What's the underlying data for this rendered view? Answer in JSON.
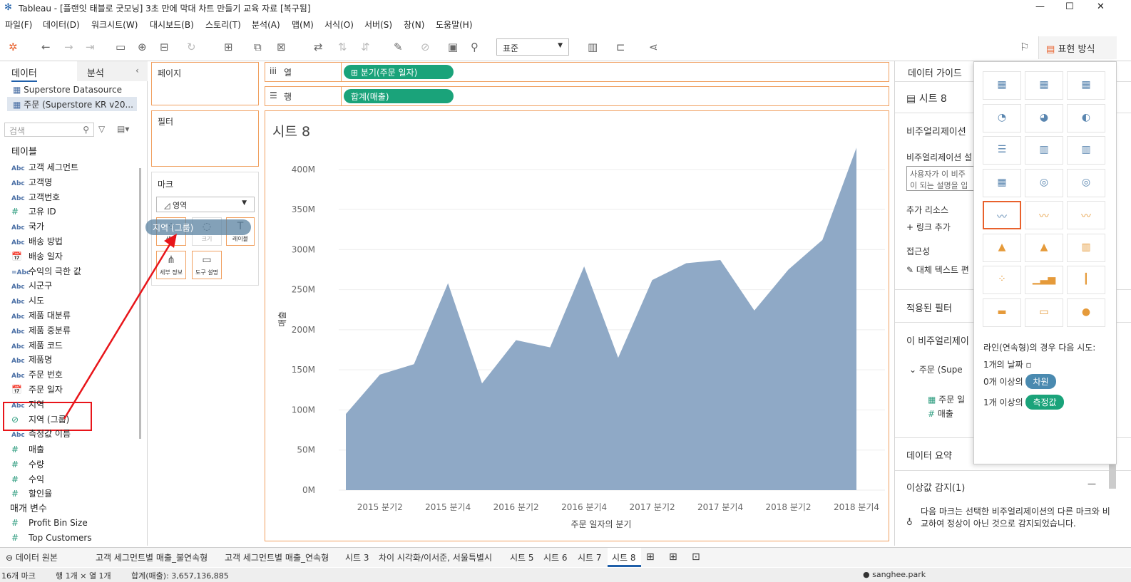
{
  "window": {
    "title": "Tableau - [플랜잇 태블로 굿모닝] 3초 만에 막대 차트 만들기 교육 자료 [복구됨]"
  },
  "menu": [
    "파일(F)",
    "데이터(D)",
    "워크시트(W)",
    "대시보드(B)",
    "스토리(T)",
    "분석(A)",
    "맵(M)",
    "서식(O)",
    "서버(S)",
    "창(N)",
    "도움말(H)"
  ],
  "toolbar": {
    "fit": "표준",
    "show_me": "표현 방식"
  },
  "left": {
    "tab_data": "데이터",
    "tab_analysis": "분석",
    "datasources": [
      "Superstore Datasource",
      "주문 (Superstore KR v20..."
    ],
    "search_placeholder": "검색",
    "tables_header": "테이블",
    "params_header": "매개 변수",
    "dimensions": [
      {
        "icon": "Abc",
        "name": "고객 세그먼트"
      },
      {
        "icon": "Abc",
        "name": "고객명"
      },
      {
        "icon": "Abc",
        "name": "고객번호"
      },
      {
        "icon": "#",
        "name": "고유 ID"
      },
      {
        "icon": "Abc",
        "name": "국가"
      },
      {
        "icon": "Abc",
        "name": "배송 방법"
      },
      {
        "icon": "📅",
        "name": "배송 일자"
      },
      {
        "icon": "=Abc",
        "name": "수익의 극한 값"
      },
      {
        "icon": "Abc",
        "name": "시군구"
      },
      {
        "icon": "Abc",
        "name": "시도"
      },
      {
        "icon": "Abc",
        "name": "제품 대분류"
      },
      {
        "icon": "Abc",
        "name": "제품 중분류"
      },
      {
        "icon": "Abc",
        "name": "제품 코드"
      },
      {
        "icon": "Abc",
        "name": "제품명"
      },
      {
        "icon": "Abc",
        "name": "주문 번호"
      },
      {
        "icon": "📅",
        "name": "주문 일자"
      },
      {
        "icon": "Abc",
        "name": "지역"
      },
      {
        "icon": "⊘",
        "name": "지역 (그룹)"
      },
      {
        "icon": "Abc",
        "name": "측정값 이름"
      }
    ],
    "measures": [
      {
        "icon": "#",
        "name": "매출"
      },
      {
        "icon": "#",
        "name": "수량"
      },
      {
        "icon": "#",
        "name": "수익"
      },
      {
        "icon": "#",
        "name": "할인율"
      }
    ],
    "params": [
      {
        "icon": "#",
        "name": "Profit Bin Size"
      },
      {
        "icon": "#",
        "name": "Top Customers"
      }
    ]
  },
  "cards": {
    "pages": "페이지",
    "filters": "필터",
    "marks": "마크",
    "mark_type": "영역",
    "columns_label": "열",
    "rows_label": "행",
    "columns_pill": "분기(주문 일자)",
    "rows_pill": "합계(매출)",
    "drag_pill": "지역 (그룹)",
    "mark_buttons": [
      "색상",
      "크기",
      "레이블",
      "세부 정보",
      "도구 설명"
    ]
  },
  "viz": {
    "title": "시트 8"
  },
  "chart_data": {
    "type": "area",
    "title": "시트 8",
    "xlabel": "주문 일자의 분기",
    "ylabel": "매출",
    "ylim": [
      0,
      430
    ],
    "grid": true,
    "x": [
      "2015 분기1",
      "2015 분기2",
      "2015 분기3",
      "2015 분기4",
      "2016 분기1",
      "2016 분기2",
      "2016 분기3",
      "2016 분기4",
      "2017 분기1",
      "2017 분기2",
      "2017 분기3",
      "2017 분기4",
      "2018 분기1",
      "2018 분기2",
      "2018 분기3",
      "2018 분기4"
    ],
    "tick_labels": [
      "2015 분기2",
      "2015 분기4",
      "2016 분기2",
      "2016 분기4",
      "2017 분기2",
      "2017 분기4",
      "2018 분기2",
      "2018 분기4"
    ],
    "y_ticks": [
      "0M",
      "50M",
      "100M",
      "150M",
      "200M",
      "250M",
      "300M",
      "350M",
      "400M"
    ],
    "values": [
      95,
      144,
      157,
      258,
      133,
      187,
      178,
      279,
      165,
      262,
      283,
      287,
      224,
      275,
      312,
      427
    ],
    "unit": "M",
    "color": "#8fa9c6"
  },
  "right": {
    "header": "데이터 가이드",
    "sheet": "시트 8",
    "viz_section": "비주얼리제이션",
    "viz_desc_label": "비주얼리제이션 설",
    "viz_desc_text": "사용자가 이 비주 이 되는 설명을 입",
    "resources": "추가 리소스",
    "add_link": "링크 추가",
    "accessibility": "접근성",
    "alt_text": "대체 텍스트 편",
    "filters": "적용된 필터",
    "this_viz": "이 비주얼리제이",
    "datasource_node": "주문 (Supe",
    "field1": "주문 일",
    "field2": "매출",
    "data_summary": "데이터 요약",
    "outliers": "이상값 감지(1)",
    "outliers_text": "다음 마크는 선택한 비주얼리제이션의 다른 마크와 비교하여 정상이 아닌 것으로 감지되었습니다."
  },
  "showme": {
    "hint": "라인(연속형)의 경우 다음 시도:",
    "req1": "1개의 날짜",
    "req2_pre": "0개 이상의",
    "req2_badge": "차원",
    "req3_pre": "1개 이상의",
    "req3_badge": "측정값"
  },
  "sheet_tabs": [
    "데이터 원본",
    "고객 세그먼트별 매출_불연속형",
    "고객 세그먼트별 매출_연속형",
    "시트 3",
    "차이 시각화/이서준, 서울특별시",
    "시트 5",
    "시트 6",
    "시트 7",
    "시트 8"
  ],
  "status": {
    "marks": "16개 마크",
    "rows_cols": "행 1개 × 열 1개",
    "sum": "합계(매출): 3,657,136,885",
    "user": "sanghee.park"
  }
}
